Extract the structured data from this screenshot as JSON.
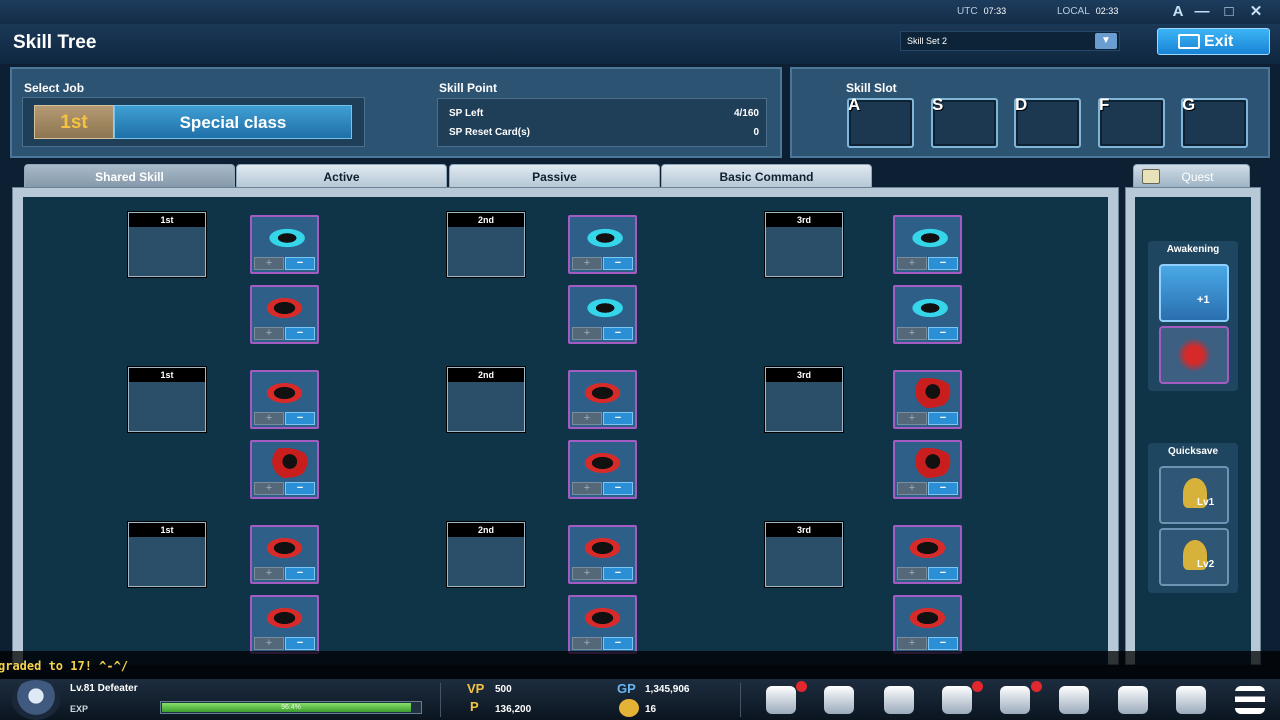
{
  "top": {
    "utc_label": "UTC",
    "utc_time": "07:33",
    "local_label": "LOCAL",
    "local_time": "02:33",
    "font_btn": "A",
    "minimize": "—",
    "maximize": "□",
    "close": "✕"
  },
  "header": {
    "title": "Skill Tree",
    "skill_set": "Skill Set 2",
    "exit_label": "Exit"
  },
  "select_job": {
    "label": "Select Job",
    "tier": "1st",
    "class_name": "Special class"
  },
  "skill_point": {
    "label": "Skill Point",
    "sp_left_label": "SP Left",
    "sp_left_value": "4/160",
    "reset_label": "SP Reset Card(s)",
    "reset_value": "0"
  },
  "skill_slot": {
    "label": "Skill Slot",
    "keys": [
      "A",
      "S",
      "D",
      "F",
      "G"
    ]
  },
  "tabs": [
    "Shared Skill",
    "Active",
    "Passive",
    "Basic Command"
  ],
  "quest_tab": "Quest",
  "tiers": [
    "1st",
    "2nd",
    "3rd"
  ],
  "side": {
    "awakening": "Awakening",
    "awakening_badge": "+1",
    "quicksave": "Quicksave",
    "q1": "Lv1",
    "q2": "Lv2"
  },
  "skill_buttons": {
    "plus": "+",
    "minus": "−"
  },
  "chat": {
    "message": "graded to 17! ^-^/"
  },
  "player": {
    "level_name": "Lv.81 Defeater",
    "exp_label": "EXP",
    "exp_text": "96.4%",
    "exp_fraction": 0.964,
    "vp_label": "VP",
    "vp": "500",
    "p_label": "P",
    "points": "136,200",
    "gp_label": "GP",
    "gp": "1,345,906",
    "coin": "16"
  }
}
